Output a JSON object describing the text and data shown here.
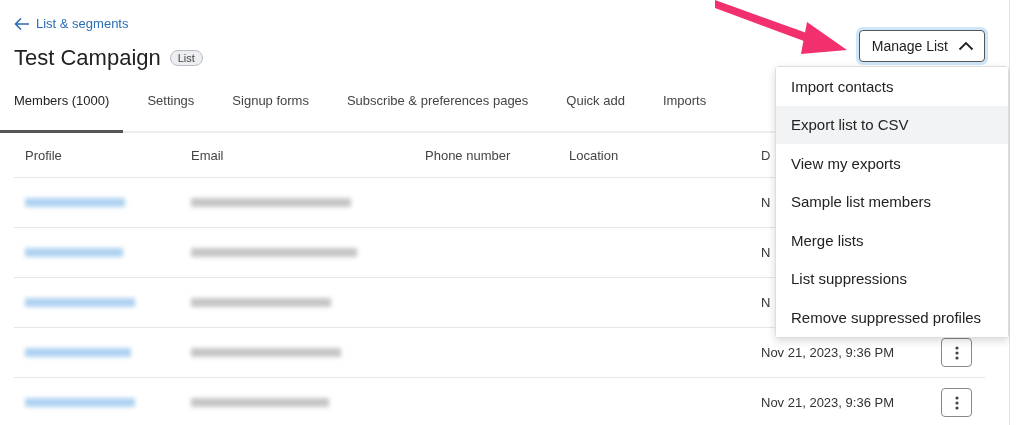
{
  "back_link": {
    "label": "List & segments"
  },
  "title": "Test Campaign",
  "badge": "List",
  "manage_button": {
    "label": "Manage List",
    "expanded": true
  },
  "tabs": [
    {
      "label": "Members (1000)",
      "selected": true
    },
    {
      "label": "Settings",
      "selected": false
    },
    {
      "label": "Signup forms",
      "selected": false
    },
    {
      "label": "Subscribe & preferences pages",
      "selected": false
    },
    {
      "label": "Quick add",
      "selected": false
    },
    {
      "label": "Imports",
      "selected": false
    }
  ],
  "table": {
    "columns": [
      "Profile",
      "Email",
      "Phone number",
      "Location",
      "D"
    ],
    "rows": [
      {
        "date": "N"
      },
      {
        "date": "N"
      },
      {
        "date": "N"
      },
      {
        "date": "Nov 21, 2023, 9:36 PM",
        "actions": true
      },
      {
        "date": "Nov 21, 2023, 9:36 PM",
        "actions": true
      }
    ]
  },
  "menu": {
    "items": [
      {
        "label": "Import contacts",
        "selected": false
      },
      {
        "label": "Export list to CSV",
        "selected": true
      },
      {
        "label": "View my exports",
        "selected": false
      },
      {
        "label": "Sample list members",
        "selected": false
      },
      {
        "label": "Merge lists",
        "selected": false
      },
      {
        "label": "List suppressions",
        "selected": false
      },
      {
        "label": "Remove suppressed profiles",
        "selected": false
      }
    ]
  }
}
